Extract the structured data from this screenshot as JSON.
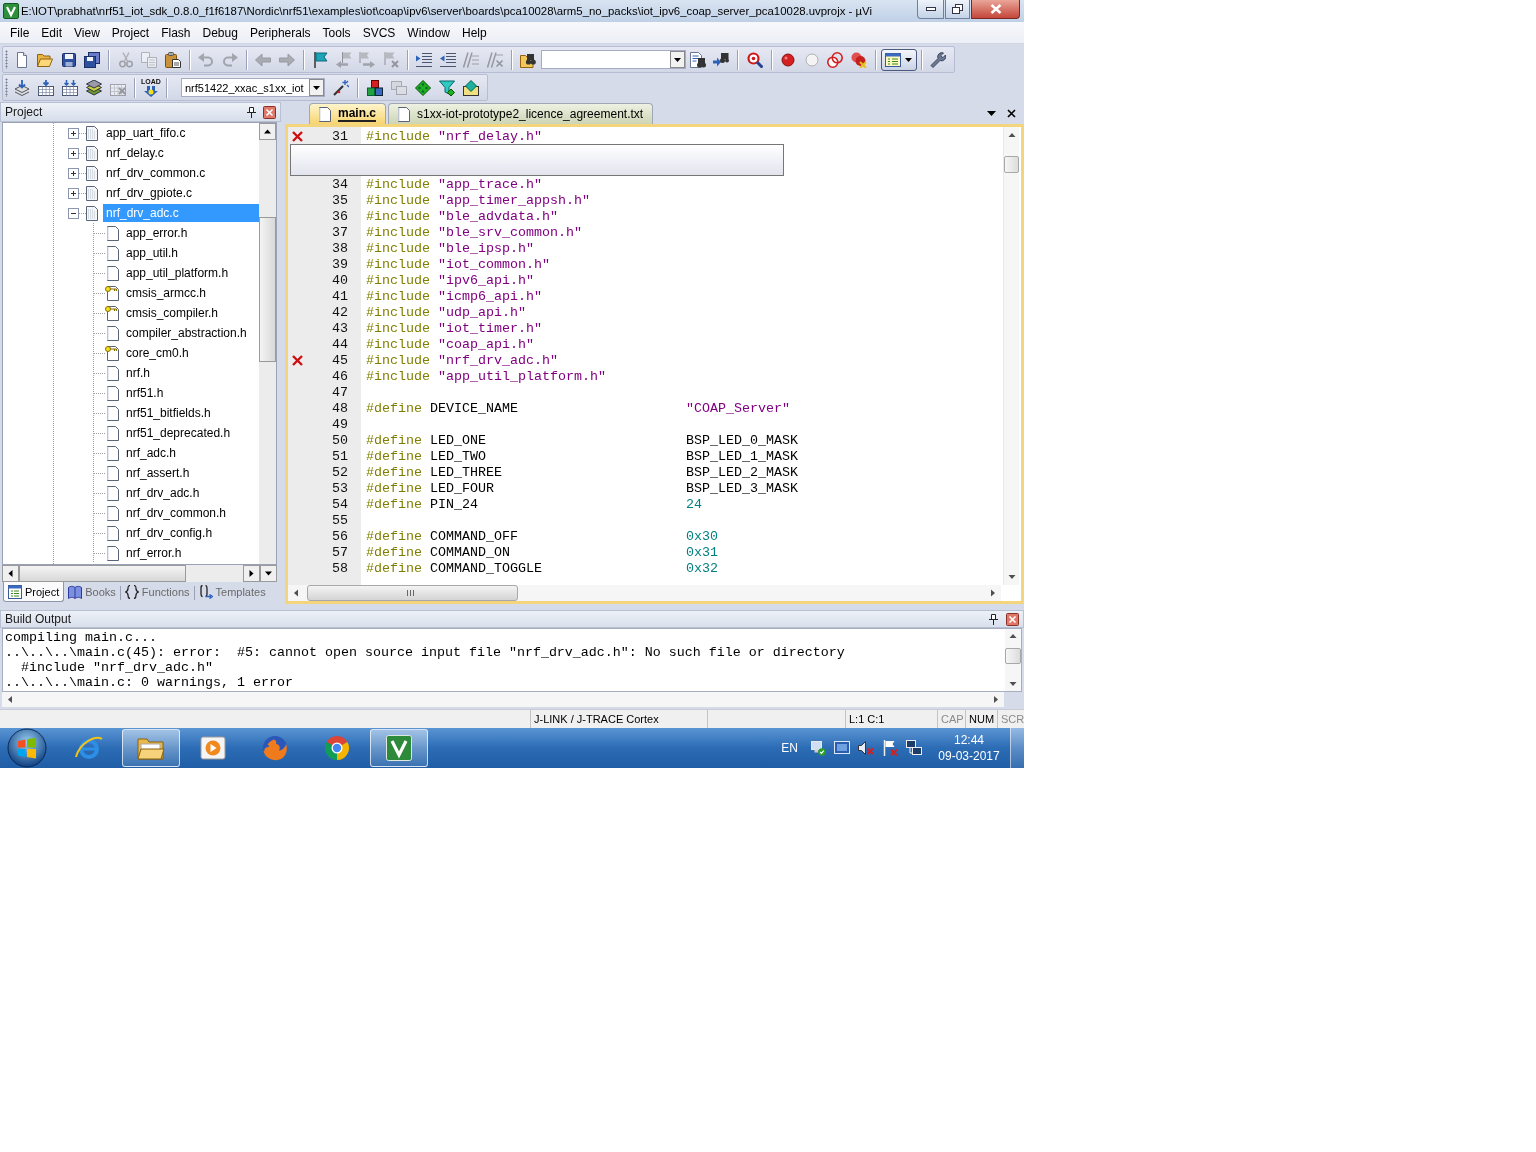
{
  "window": {
    "title": "E:\\IOT\\prabhat\\nrf51_iot_sdk_0.8.0_f1f6187\\Nordic\\nrf51\\examples\\iot\\coap\\ipv6\\server\\boards\\pca10028\\arm5_no_packs\\iot_ipv6_coap_server_pca10028.uvprojx - µVi"
  },
  "menu": [
    "File",
    "Edit",
    "View",
    "Project",
    "Flash",
    "Debug",
    "Peripherals",
    "Tools",
    "SVCS",
    "Window",
    "Help"
  ],
  "toolbars": [
    {
      "groups": [
        {
          "items": [
            {
              "kind": "page",
              "disabled": false
            },
            {
              "kind": "folder",
              "disabled": false
            },
            {
              "kind": "floppy",
              "disabled": false
            },
            {
              "kind": "floppies",
              "disabled": false
            }
          ]
        },
        {
          "items": [
            {
              "kind": "scissors",
              "disabled": true
            },
            {
              "kind": "pages",
              "disabled": true
            },
            {
              "kind": "clipboard",
              "disabled": false
            }
          ]
        },
        {
          "items": [
            {
              "kind": "undo",
              "disabled": true
            },
            {
              "kind": "redo",
              "disabled": true
            }
          ]
        },
        {
          "items": [
            {
              "kind": "arrow-left",
              "disabled": true
            },
            {
              "kind": "arrow-right",
              "disabled": true
            }
          ]
        },
        {
          "items": [
            {
              "kind": "flag",
              "disabled": false
            },
            {
              "kind": "flag-left",
              "disabled": true
            },
            {
              "kind": "flag-right",
              "disabled": true
            },
            {
              "kind": "flag-cross",
              "disabled": true
            }
          ]
        },
        {
          "items": [
            {
              "kind": "indent",
              "disabled": false
            },
            {
              "kind": "outdent",
              "disabled": false
            },
            {
              "kind": "comment-lines",
              "disabled": true
            },
            {
              "kind": "uncomment-lines",
              "disabled": true
            }
          ]
        },
        {
          "items": [
            {
              "kind": "folder-binoculars",
              "disabled": false
            },
            {
              "kind": "combo"
            },
            {
              "kind": "page-binoculars",
              "disabled": false
            },
            {
              "kind": "binoculars-arrow",
              "disabled": false
            }
          ]
        },
        {
          "items": [
            {
              "kind": "magnifier",
              "disabled": false
            }
          ]
        },
        {
          "items": [
            {
              "kind": "dot",
              "disabled": false
            },
            {
              "kind": "circle",
              "disabled": false
            },
            {
              "kind": "rings",
              "disabled": false
            },
            {
              "kind": "rings-cross",
              "disabled": false
            }
          ]
        },
        {
          "items": [
            {
              "kind": "layout-dropdown",
              "pressed": true
            }
          ]
        },
        {
          "items": [
            {
              "kind": "wrench",
              "disabled": false
            }
          ]
        }
      ]
    },
    {
      "groups": [
        {
          "items": [
            {
              "kind": "stack-arrow",
              "disabled": false
            },
            {
              "kind": "grid-arrow",
              "disabled": false
            },
            {
              "kind": "grid-arrows",
              "disabled": false
            },
            {
              "kind": "layers",
              "disabled": false
            },
            {
              "kind": "grid-cross",
              "disabled": true
            }
          ]
        },
        {
          "items": [
            {
              "kind": "download",
              "label": "LOAD",
              "disabled": false
            }
          ]
        },
        {
          "items": [
            {
              "kind": "combo",
              "value": "nrf51422_xxac_s1xx_iot"
            },
            {
              "kind": "wand",
              "disabled": false
            }
          ]
        },
        {
          "items": [
            {
              "kind": "blocks",
              "disabled": false
            },
            {
              "kind": "windows",
              "disabled": true
            },
            {
              "kind": "diamond",
              "disabled": false
            },
            {
              "kind": "funnel-diamond",
              "disabled": false
            },
            {
              "kind": "diamond-box",
              "disabled": false
            }
          ]
        }
      ]
    }
  ],
  "project_panel": {
    "title": "Project",
    "tree": [
      {
        "label": "app_uart_fifo.c",
        "expanded": false,
        "selected": false
      },
      {
        "label": "nrf_delay.c",
        "expanded": false,
        "selected": false
      },
      {
        "label": "nrf_drv_common.c",
        "expanded": false,
        "selected": false
      },
      {
        "label": "nrf_drv_gpiote.c",
        "expanded": false,
        "selected": false
      },
      {
        "label": "nrf_drv_adc.c",
        "expanded": true,
        "selected": true,
        "children": [
          {
            "label": "app_error.h",
            "read_only": false,
            "selected": false
          },
          {
            "label": "app_util.h",
            "read_only": false,
            "selected": false
          },
          {
            "label": "app_util_platform.h",
            "read_only": false,
            "selected": false
          },
          {
            "label": "cmsis_armcc.h",
            "read_only": true,
            "selected": false
          },
          {
            "label": "cmsis_compiler.h",
            "read_only": true,
            "selected": false
          },
          {
            "label": "compiler_abstraction.h",
            "read_only": false,
            "selected": false
          },
          {
            "label": "core_cm0.h",
            "read_only": true,
            "selected": false
          },
          {
            "label": "nrf.h",
            "read_only": false,
            "selected": false
          },
          {
            "label": "nrf51.h",
            "read_only": false,
            "selected": false
          },
          {
            "label": "nrf51_bitfields.h",
            "read_only": false,
            "selected": false
          },
          {
            "label": "nrf51_deprecated.h",
            "read_only": false,
            "selected": false
          },
          {
            "label": "nrf_adc.h",
            "read_only": false,
            "selected": false
          },
          {
            "label": "nrf_assert.h",
            "read_only": false,
            "selected": false
          },
          {
            "label": "nrf_drv_adc.h",
            "read_only": false,
            "selected": false
          },
          {
            "label": "nrf_drv_common.h",
            "read_only": false,
            "selected": false
          },
          {
            "label": "nrf_drv_config.h",
            "read_only": false,
            "selected": false
          },
          {
            "label": "nrf_error.h",
            "read_only": false,
            "selected": false
          }
        ]
      }
    ],
    "tabs": [
      {
        "label": "Project",
        "kind": "list-window",
        "selected": true
      },
      {
        "label": "Books",
        "kind": "book",
        "selected": false
      },
      {
        "label": "Functions",
        "kind": "braces",
        "selected": false
      },
      {
        "label": "Templates",
        "kind": "braces-arrow",
        "selected": false
      }
    ]
  },
  "editor": {
    "tabs": [
      {
        "label": "main.c",
        "selected": true
      },
      {
        "label": "s1xx-iot-prototype2_licence_agreement.txt",
        "selected": false
      }
    ],
    "lines": [
      {
        "number": "31",
        "kind": "include",
        "directive": "#include",
        "path": "\"nrf_delay.h\"",
        "error": true
      },
      {
        "kind": "tooltip"
      },
      {
        "number": "34",
        "kind": "include",
        "directive": "#include",
        "path": "\"app_trace.h\"",
        "error": false
      },
      {
        "number": "35",
        "kind": "include",
        "directive": "#include",
        "path": "\"app_timer_appsh.h\"",
        "error": false
      },
      {
        "number": "36",
        "kind": "include",
        "directive": "#include",
        "path": "\"ble_advdata.h\"",
        "error": false
      },
      {
        "number": "37",
        "kind": "include",
        "directive": "#include",
        "path": "\"ble_srv_common.h\"",
        "error": false
      },
      {
        "number": "38",
        "kind": "include",
        "directive": "#include",
        "path": "\"ble_ipsp.h\"",
        "error": false
      },
      {
        "number": "39",
        "kind": "include",
        "directive": "#include",
        "path": "\"iot_common.h\"",
        "error": false
      },
      {
        "number": "40",
        "kind": "include",
        "directive": "#include",
        "path": "\"ipv6_api.h\"",
        "error": false
      },
      {
        "number": "41",
        "kind": "include",
        "directive": "#include",
        "path": "\"icmp6_api.h\"",
        "error": false
      },
      {
        "number": "42",
        "kind": "include",
        "directive": "#include",
        "path": "\"udp_api.h\"",
        "error": false
      },
      {
        "number": "43",
        "kind": "include",
        "directive": "#include",
        "path": "\"iot_timer.h\"",
        "error": false
      },
      {
        "number": "44",
        "kind": "include",
        "directive": "#include",
        "path": "\"coap_api.h\"",
        "error": false
      },
      {
        "number": "45",
        "kind": "include",
        "directive": "#include",
        "path": "\"nrf_drv_adc.h\"",
        "error": true
      },
      {
        "number": "46",
        "kind": "include",
        "directive": "#include",
        "path": "\"app_util_platform.h\"",
        "error": false
      },
      {
        "number": "47",
        "kind": "blank",
        "error": false
      },
      {
        "number": "48",
        "kind": "define",
        "directive": "#define",
        "name": "DEVICE_NAME",
        "value": {
          "kind": "string",
          "text": "\"COAP_Server\""
        },
        "error": false
      },
      {
        "number": "49",
        "kind": "blank",
        "error": false
      },
      {
        "number": "50",
        "kind": "define",
        "directive": "#define",
        "name": "LED_ONE",
        "value": {
          "kind": "identifier",
          "text": "BSP_LED_0_MASK"
        },
        "error": false
      },
      {
        "number": "51",
        "kind": "define",
        "directive": "#define",
        "name": "LED_TWO",
        "value": {
          "kind": "identifier",
          "text": "BSP_LED_1_MASK"
        },
        "error": false
      },
      {
        "number": "52",
        "kind": "define",
        "directive": "#define",
        "name": "LED_THREE",
        "value": {
          "kind": "identifier",
          "text": "BSP_LED_2_MASK"
        },
        "error": false
      },
      {
        "number": "53",
        "kind": "define",
        "directive": "#define",
        "name": "LED_FOUR",
        "value": {
          "kind": "identifier",
          "text": "BSP_LED_3_MASK"
        },
        "error": false
      },
      {
        "number": "54",
        "kind": "define",
        "directive": "#define",
        "name": "PIN_24",
        "value": {
          "kind": "number",
          "text": "24"
        },
        "error": false
      },
      {
        "number": "55",
        "kind": "blank",
        "error": false
      },
      {
        "number": "56",
        "kind": "define",
        "directive": "#define",
        "name": "COMMAND_OFF",
        "value": {
          "kind": "number",
          "text": "0x30"
        },
        "error": false
      },
      {
        "number": "57",
        "kind": "define",
        "directive": "#define",
        "name": "COMMAND_ON",
        "value": {
          "kind": "number",
          "text": "0x31"
        },
        "error": false
      },
      {
        "number": "58",
        "kind": "define",
        "directive": "#define",
        "name": "COMMAND_TOGGLE",
        "value": {
          "kind": "number",
          "text": "0x32"
        },
        "error": false
      }
    ]
  },
  "build_output": {
    "title": "Build Output",
    "lines": [
      "compiling main.c...",
      "..\\..\\..\\main.c(45): error:  #5: cannot open source input file \"nrf_drv_adc.h\": No such file or directory",
      "  #include \"nrf_drv_adc.h\"",
      "..\\..\\..\\main.c: 0 warnings, 1 error"
    ]
  },
  "status_bar": {
    "debugger": "J-LINK / J-TRACE Cortex",
    "position": "L:1 C:1",
    "indicators": [
      {
        "label": "CAP",
        "on": false
      },
      {
        "label": "NUM",
        "on": true
      },
      {
        "label": "SCR",
        "on": false
      }
    ]
  },
  "taskbar": {
    "apps": [
      {
        "kind": "ring-swoosh",
        "running": false
      },
      {
        "kind": "folder",
        "running": true
      },
      {
        "kind": "play-tile",
        "running": false
      },
      {
        "kind": "globe",
        "running": false
      },
      {
        "kind": "segmented-ring",
        "running": false
      },
      {
        "kind": "chevron-tile",
        "running": true
      }
    ],
    "language": "EN",
    "tray": [
      {
        "kind": "computer-check"
      },
      {
        "kind": "screen"
      },
      {
        "kind": "speaker-muted"
      },
      {
        "kind": "flag-cross"
      },
      {
        "kind": "monitors"
      }
    ],
    "time": "12:44",
    "date": "09-03-2017"
  }
}
